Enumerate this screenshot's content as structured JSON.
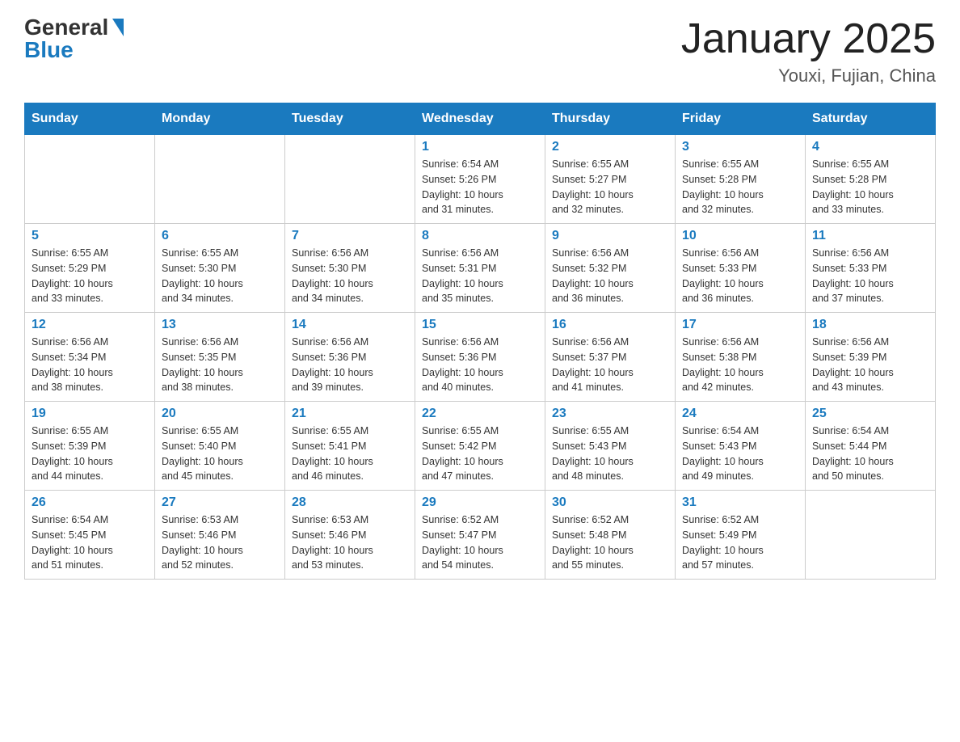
{
  "header": {
    "logo": {
      "general": "General",
      "blue": "Blue"
    },
    "title": "January 2025",
    "location": "Youxi, Fujian, China"
  },
  "calendar": {
    "days_of_week": [
      "Sunday",
      "Monday",
      "Tuesday",
      "Wednesday",
      "Thursday",
      "Friday",
      "Saturday"
    ],
    "weeks": [
      [
        {
          "day": "",
          "info": ""
        },
        {
          "day": "",
          "info": ""
        },
        {
          "day": "",
          "info": ""
        },
        {
          "day": "1",
          "info": "Sunrise: 6:54 AM\nSunset: 5:26 PM\nDaylight: 10 hours\nand 31 minutes."
        },
        {
          "day": "2",
          "info": "Sunrise: 6:55 AM\nSunset: 5:27 PM\nDaylight: 10 hours\nand 32 minutes."
        },
        {
          "day": "3",
          "info": "Sunrise: 6:55 AM\nSunset: 5:28 PM\nDaylight: 10 hours\nand 32 minutes."
        },
        {
          "day": "4",
          "info": "Sunrise: 6:55 AM\nSunset: 5:28 PM\nDaylight: 10 hours\nand 33 minutes."
        }
      ],
      [
        {
          "day": "5",
          "info": "Sunrise: 6:55 AM\nSunset: 5:29 PM\nDaylight: 10 hours\nand 33 minutes."
        },
        {
          "day": "6",
          "info": "Sunrise: 6:55 AM\nSunset: 5:30 PM\nDaylight: 10 hours\nand 34 minutes."
        },
        {
          "day": "7",
          "info": "Sunrise: 6:56 AM\nSunset: 5:30 PM\nDaylight: 10 hours\nand 34 minutes."
        },
        {
          "day": "8",
          "info": "Sunrise: 6:56 AM\nSunset: 5:31 PM\nDaylight: 10 hours\nand 35 minutes."
        },
        {
          "day": "9",
          "info": "Sunrise: 6:56 AM\nSunset: 5:32 PM\nDaylight: 10 hours\nand 36 minutes."
        },
        {
          "day": "10",
          "info": "Sunrise: 6:56 AM\nSunset: 5:33 PM\nDaylight: 10 hours\nand 36 minutes."
        },
        {
          "day": "11",
          "info": "Sunrise: 6:56 AM\nSunset: 5:33 PM\nDaylight: 10 hours\nand 37 minutes."
        }
      ],
      [
        {
          "day": "12",
          "info": "Sunrise: 6:56 AM\nSunset: 5:34 PM\nDaylight: 10 hours\nand 38 minutes."
        },
        {
          "day": "13",
          "info": "Sunrise: 6:56 AM\nSunset: 5:35 PM\nDaylight: 10 hours\nand 38 minutes."
        },
        {
          "day": "14",
          "info": "Sunrise: 6:56 AM\nSunset: 5:36 PM\nDaylight: 10 hours\nand 39 minutes."
        },
        {
          "day": "15",
          "info": "Sunrise: 6:56 AM\nSunset: 5:36 PM\nDaylight: 10 hours\nand 40 minutes."
        },
        {
          "day": "16",
          "info": "Sunrise: 6:56 AM\nSunset: 5:37 PM\nDaylight: 10 hours\nand 41 minutes."
        },
        {
          "day": "17",
          "info": "Sunrise: 6:56 AM\nSunset: 5:38 PM\nDaylight: 10 hours\nand 42 minutes."
        },
        {
          "day": "18",
          "info": "Sunrise: 6:56 AM\nSunset: 5:39 PM\nDaylight: 10 hours\nand 43 minutes."
        }
      ],
      [
        {
          "day": "19",
          "info": "Sunrise: 6:55 AM\nSunset: 5:39 PM\nDaylight: 10 hours\nand 44 minutes."
        },
        {
          "day": "20",
          "info": "Sunrise: 6:55 AM\nSunset: 5:40 PM\nDaylight: 10 hours\nand 45 minutes."
        },
        {
          "day": "21",
          "info": "Sunrise: 6:55 AM\nSunset: 5:41 PM\nDaylight: 10 hours\nand 46 minutes."
        },
        {
          "day": "22",
          "info": "Sunrise: 6:55 AM\nSunset: 5:42 PM\nDaylight: 10 hours\nand 47 minutes."
        },
        {
          "day": "23",
          "info": "Sunrise: 6:55 AM\nSunset: 5:43 PM\nDaylight: 10 hours\nand 48 minutes."
        },
        {
          "day": "24",
          "info": "Sunrise: 6:54 AM\nSunset: 5:43 PM\nDaylight: 10 hours\nand 49 minutes."
        },
        {
          "day": "25",
          "info": "Sunrise: 6:54 AM\nSunset: 5:44 PM\nDaylight: 10 hours\nand 50 minutes."
        }
      ],
      [
        {
          "day": "26",
          "info": "Sunrise: 6:54 AM\nSunset: 5:45 PM\nDaylight: 10 hours\nand 51 minutes."
        },
        {
          "day": "27",
          "info": "Sunrise: 6:53 AM\nSunset: 5:46 PM\nDaylight: 10 hours\nand 52 minutes."
        },
        {
          "day": "28",
          "info": "Sunrise: 6:53 AM\nSunset: 5:46 PM\nDaylight: 10 hours\nand 53 minutes."
        },
        {
          "day": "29",
          "info": "Sunrise: 6:52 AM\nSunset: 5:47 PM\nDaylight: 10 hours\nand 54 minutes."
        },
        {
          "day": "30",
          "info": "Sunrise: 6:52 AM\nSunset: 5:48 PM\nDaylight: 10 hours\nand 55 minutes."
        },
        {
          "day": "31",
          "info": "Sunrise: 6:52 AM\nSunset: 5:49 PM\nDaylight: 10 hours\nand 57 minutes."
        },
        {
          "day": "",
          "info": ""
        }
      ]
    ]
  }
}
